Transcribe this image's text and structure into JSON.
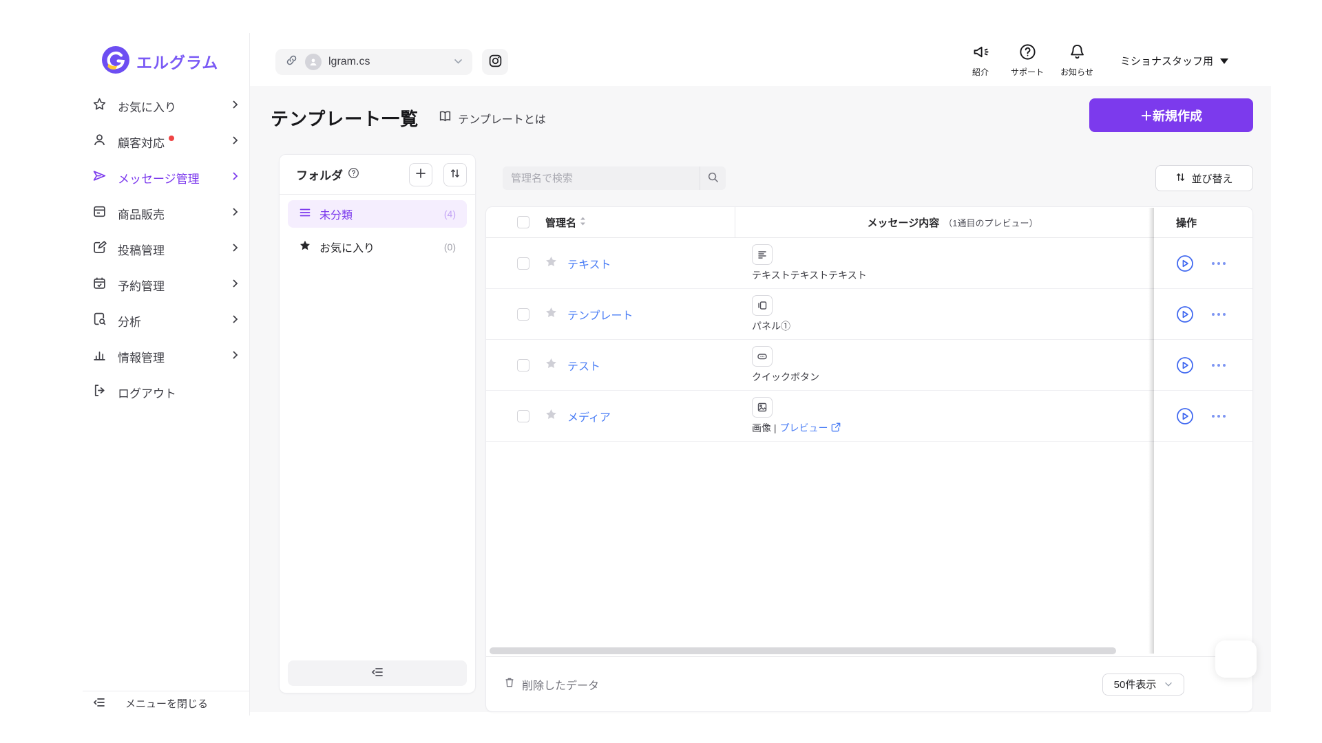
{
  "brand": {
    "name": "エルグラム",
    "accent_color": "#7c3aed"
  },
  "header": {
    "account": {
      "name": "lgram.cs"
    },
    "quick_links": [
      {
        "label": "紹介",
        "icon": "megaphone-icon"
      },
      {
        "label": "サポート",
        "icon": "question-circle-icon"
      },
      {
        "label": "お知らせ",
        "icon": "bell-icon"
      }
    ],
    "account_menu_label": "ミショナスタッフ用"
  },
  "sidebar": {
    "items": [
      {
        "label": "お気に入り",
        "icon": "star-icon"
      },
      {
        "label": "顧客対応",
        "icon": "person-icon",
        "has_alert_dot": true
      },
      {
        "label": "メッセージ管理",
        "icon": "send-icon",
        "active": true
      },
      {
        "label": "商品販売",
        "icon": "storefront-icon"
      },
      {
        "label": "投稿管理",
        "icon": "edit-icon"
      },
      {
        "label": "予約管理",
        "icon": "calendar-icon"
      },
      {
        "label": "分析",
        "icon": "doc-search-icon"
      },
      {
        "label": "情報管理",
        "icon": "bar-chart-icon"
      },
      {
        "label": "ログアウト",
        "icon": "logout-icon"
      }
    ],
    "close_menu_label": "メニューを閉じる"
  },
  "page": {
    "title": "テンプレート一覧",
    "help_link_label": "テンプレートとは",
    "create_button_label": "＋新規作成"
  },
  "folders": {
    "title": "フォルダ",
    "items": [
      {
        "label": "未分類",
        "count": "(4)",
        "icon": "list-icon",
        "active": true
      },
      {
        "label": "お気に入り",
        "count": "(0)",
        "icon": "star-filled-icon",
        "active": false
      }
    ]
  },
  "toolbar": {
    "search_placeholder": "管理名で検索",
    "sort_button_label": "並び替え"
  },
  "table": {
    "columns": {
      "name": "管理名",
      "message": "メッセージ内容",
      "message_note": "（1通目のプレビュー）",
      "actions": "操作"
    },
    "rows": [
      {
        "name": "テキスト",
        "type_icon": "text-message-icon",
        "preview": "テキストテキストテキスト"
      },
      {
        "name": "テンプレート",
        "type_icon": "panel-message-icon",
        "preview": "パネル①"
      },
      {
        "name": "テスト",
        "type_icon": "quick-button-message-icon",
        "preview": "クイックボタン"
      },
      {
        "name": "メディア",
        "type_icon": "image-message-icon",
        "preview": "画像 |",
        "preview_link": "プレビュー"
      }
    ]
  },
  "footer": {
    "deleted_data_label": "削除したデータ",
    "page_size_label": "50件表示"
  }
}
